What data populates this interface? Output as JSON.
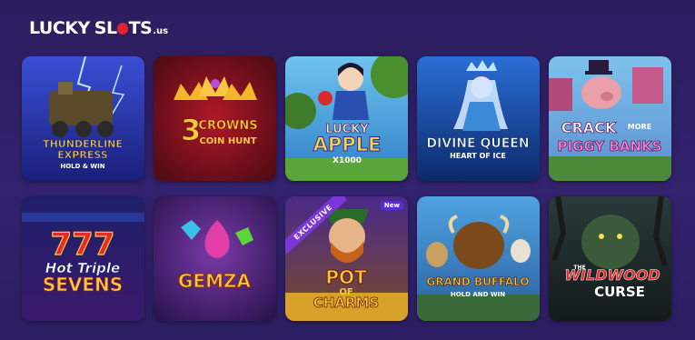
{
  "logo": {
    "word1": "LUCKY",
    "word2a": "SL",
    "word2b": "TS",
    "tld": ".us"
  },
  "games": [
    {
      "title_lines": [
        "THUNDERLINE",
        "EXPRESS",
        "HOLD & WIN"
      ]
    },
    {
      "title_lines": [
        "3",
        "CROWNS",
        "COIN HUNT"
      ]
    },
    {
      "title_lines": [
        "LUCKY",
        "APPLE",
        "X1000"
      ]
    },
    {
      "title_lines": [
        "DIVINE QUEEN",
        "HEART OF ICE"
      ]
    },
    {
      "title_lines": [
        "CRACK",
        "MORE",
        "PIGGY BANKS"
      ]
    },
    {
      "title_lines": [
        "777",
        "Hot Triple",
        "SEVENS"
      ]
    },
    {
      "title_lines": [
        "GEMZA"
      ]
    },
    {
      "title_lines": [
        "POT",
        "OF",
        "CHARMS"
      ],
      "badge": "New",
      "ribbon": "EXCLUSIVE"
    },
    {
      "title_lines": [
        "GRAND BUFFALO",
        "HOLD AND WIN"
      ]
    },
    {
      "title_lines": [
        "THE",
        "WILDWOOD",
        "CURSE"
      ]
    }
  ],
  "colors": {
    "page_bg": "#2e1f66",
    "logo_accent": "#e2222e",
    "badge": "#5b2bd8"
  }
}
